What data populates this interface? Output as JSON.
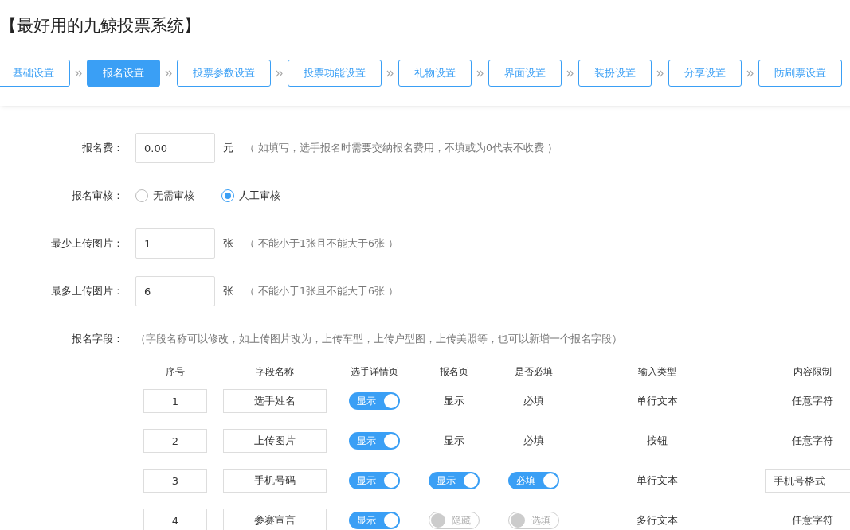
{
  "title": "【最好用的九鲸投票系统】",
  "steps": [
    {
      "label": "基础设置",
      "selected": false
    },
    {
      "label": "报名设置",
      "selected": true
    },
    {
      "label": "投票参数设置",
      "selected": false
    },
    {
      "label": "投票功能设置",
      "selected": false
    },
    {
      "label": "礼物设置",
      "selected": false
    },
    {
      "label": "界面设置",
      "selected": false
    },
    {
      "label": "装扮设置",
      "selected": false
    },
    {
      "label": "分享设置",
      "selected": false
    },
    {
      "label": "防刷票设置",
      "selected": false
    }
  ],
  "fee": {
    "label": "报名费：",
    "value": "0.00",
    "unit": "元",
    "hint": "（ 如填写，选手报名时需要交纳报名费用，不填或为0代表不收费 ）"
  },
  "review": {
    "label": "报名审核：",
    "options": [
      {
        "label": "无需审核",
        "selected": false
      },
      {
        "label": "人工审核",
        "selected": true
      }
    ]
  },
  "min_images": {
    "label": "最少上传图片：",
    "value": "1",
    "unit": "张",
    "hint": "（ 不能小于1张且不能大于6张 ）"
  },
  "max_images": {
    "label": "最多上传图片：",
    "value": "6",
    "unit": "张",
    "hint": "（ 不能小于1张且不能大于6张 ）"
  },
  "fields": {
    "label": "报名字段：",
    "hint": "（字段名称可以修改，如上传图片改为，上传车型，上传户型图，上传美照等，也可以新增一个报名字段）",
    "columns": [
      "序号",
      "字段名称",
      "选手详情页",
      "报名页",
      "是否必填",
      "输入类型",
      "内容限制"
    ],
    "rows": [
      {
        "index": "1",
        "name": "选手姓名",
        "detail": {
          "kind": "toggle",
          "on": true,
          "label": "显示"
        },
        "signup": {
          "kind": "text",
          "label": "显示"
        },
        "required": {
          "kind": "text",
          "label": "必填"
        },
        "input_type": "单行文本",
        "limit": {
          "kind": "text",
          "value": "任意字符"
        }
      },
      {
        "index": "2",
        "name": "上传图片",
        "detail": {
          "kind": "toggle",
          "on": true,
          "label": "显示"
        },
        "signup": {
          "kind": "text",
          "label": "显示"
        },
        "required": {
          "kind": "text",
          "label": "必填"
        },
        "input_type": "按钮",
        "limit": {
          "kind": "text",
          "value": "任意字符"
        }
      },
      {
        "index": "3",
        "name": "手机号码",
        "detail": {
          "kind": "toggle",
          "on": true,
          "label": "显示"
        },
        "signup": {
          "kind": "toggle",
          "on": true,
          "label": "显示"
        },
        "required": {
          "kind": "toggle",
          "on": true,
          "label": "必填"
        },
        "input_type": "单行文本",
        "limit": {
          "kind": "select",
          "value": "手机号格式"
        }
      },
      {
        "index": "4",
        "name": "参赛宣言",
        "detail": {
          "kind": "toggle",
          "on": true,
          "label": "显示"
        },
        "signup": {
          "kind": "toggle",
          "on": false,
          "label": "隐藏"
        },
        "required": {
          "kind": "toggle",
          "on": false,
          "label": "选填"
        },
        "input_type": "多行文本",
        "limit": {
          "kind": "text",
          "value": "任意字符"
        }
      }
    ]
  }
}
